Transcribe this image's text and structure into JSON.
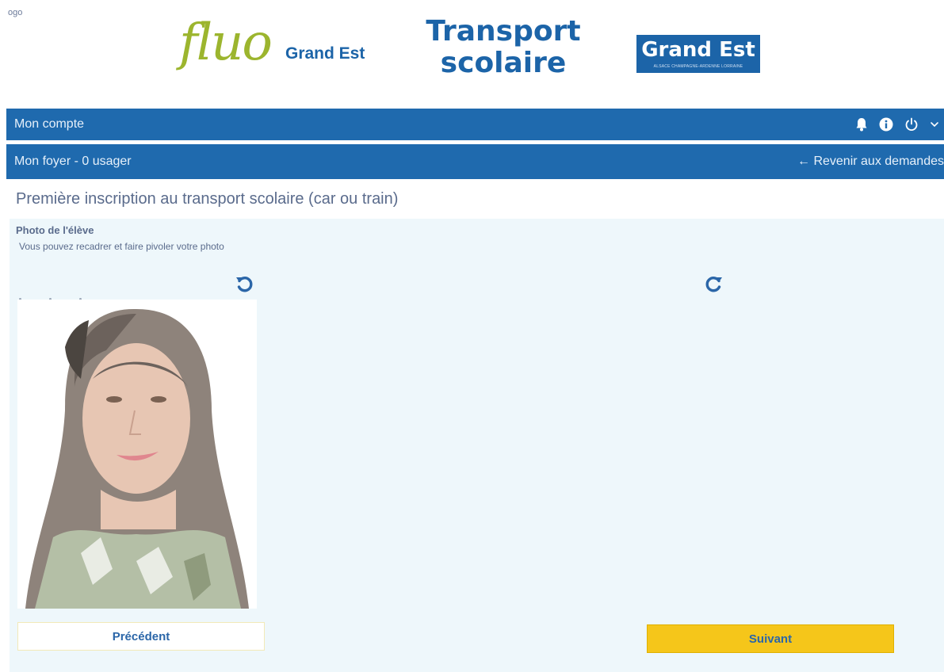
{
  "header": {
    "logo_alt": "ogo",
    "fluo_word": "fluo",
    "fluo_sub": "Grand Est",
    "title_line1": "Transport",
    "title_line2": "scolaire",
    "region_logo": "Grand Est",
    "region_tagline": "ALSACE CHAMPAGNE-ARDENNE LORRAINE"
  },
  "account_bar": {
    "label": "Mon compte",
    "icons": [
      "bell-icon",
      "info-icon",
      "power-icon",
      "chevron-down-icon"
    ]
  },
  "household_bar": {
    "label": "Mon foyer - 0 usager",
    "back_link": "Revenir aux demandes"
  },
  "page": {
    "title": "Première inscription au transport scolaire (car ou train)"
  },
  "photo_section": {
    "label": "Photo de l'élève",
    "help": "Vous pouvez recadrer et faire pivoler votre photo",
    "rotate_left_icon": "rotate-left-icon",
    "rotate_right_icon": "rotate-right-icon"
  },
  "buttons": {
    "previous": "Précédent",
    "next": "Suivant"
  },
  "colors": {
    "brand_blue": "#1f6aae",
    "fluo_green": "#9cb52e",
    "accent_yellow": "#f5c61a",
    "panel_bg": "#eef7fb"
  }
}
